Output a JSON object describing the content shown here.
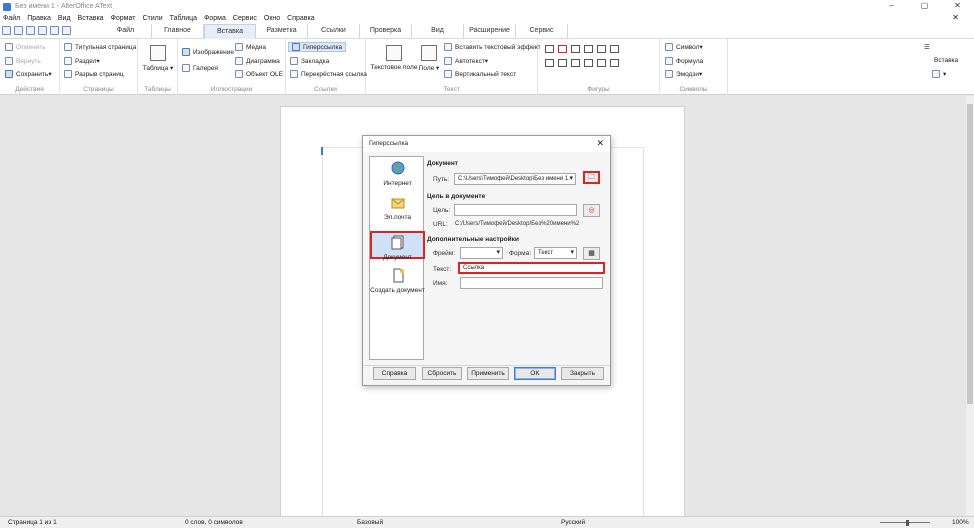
{
  "window": {
    "title": "Без имени 1 - AlterOffice AText"
  },
  "menu": [
    "Файл",
    "Правка",
    "Вид",
    "Вставка",
    "Формат",
    "Стили",
    "Таблица",
    "Форма",
    "Сервис",
    "Окно",
    "Справка"
  ],
  "tabs": [
    "Файл",
    "Главное",
    "Вставка",
    "Разметка",
    "Ссылки",
    "Проверка",
    "Вид",
    "Расширение",
    "Сервис"
  ],
  "ribbon": {
    "undo": "Отменить",
    "redo": "Вернуть",
    "save": "Сохранить",
    "title_page": "Титульная страница",
    "section": "Раздел",
    "page_break": "Разрыв страниц",
    "table": "Таблица",
    "image": "Изображение",
    "gallery": "Галерея",
    "media": "Медиа",
    "chart": "Диаграмма",
    "ole": "Объект OLE",
    "hyperlink": "Гиперссылка",
    "bookmark": "Закладка",
    "cross_ref": "Перекрёстная ссылка",
    "text_box": "Текстовое поле",
    "field": "Поле",
    "text_effect": "Вставить текстовый эффект",
    "autotext": "Автотекст",
    "vertical_text": "Вертикальный текст",
    "symbol": "Символ",
    "formula": "Формула",
    "emoji": "Эмодзи",
    "insert": "Вставка",
    "groups": {
      "actions": "Действия",
      "pages": "Страницы",
      "tables": "Таблицы",
      "illustrations": "Иллюстрации",
      "links": "Ссылки",
      "text": "Текст",
      "shapes": "Фигуры",
      "symbols": "Символы"
    }
  },
  "dialog": {
    "title": "Гиперссылка",
    "sidebar": [
      "Интернет",
      "Эл.почта",
      "Документ",
      "Создать документ"
    ],
    "doc_section": "Документ",
    "path_label": "Путь:",
    "path_value": "C:\\Users\\Тимофей\\Desktop\\Без имени 1.",
    "target_section": "Цель в документе",
    "target_label": "Цель:",
    "url_label": "URL:",
    "url_value": "C:/Users/Тимофей/Desktop/Без%20имени%2",
    "extra_section": "Дополнительные настройки",
    "frame_label": "Фрейм:",
    "form_label": "Форма:",
    "form_value": "Текст",
    "text_label": "Текст:",
    "text_value": "Ссылка",
    "name_label": "Имя:",
    "buttons": {
      "help": "Справка",
      "reset": "Сбросить",
      "apply": "Применить",
      "ok": "OK",
      "close": "Закрыть"
    }
  },
  "status": {
    "page": "Страница 1 из 1",
    "words": "0 слов, 0 символов",
    "style": "Базовый",
    "language": "Русский",
    "zoom": "100%"
  }
}
